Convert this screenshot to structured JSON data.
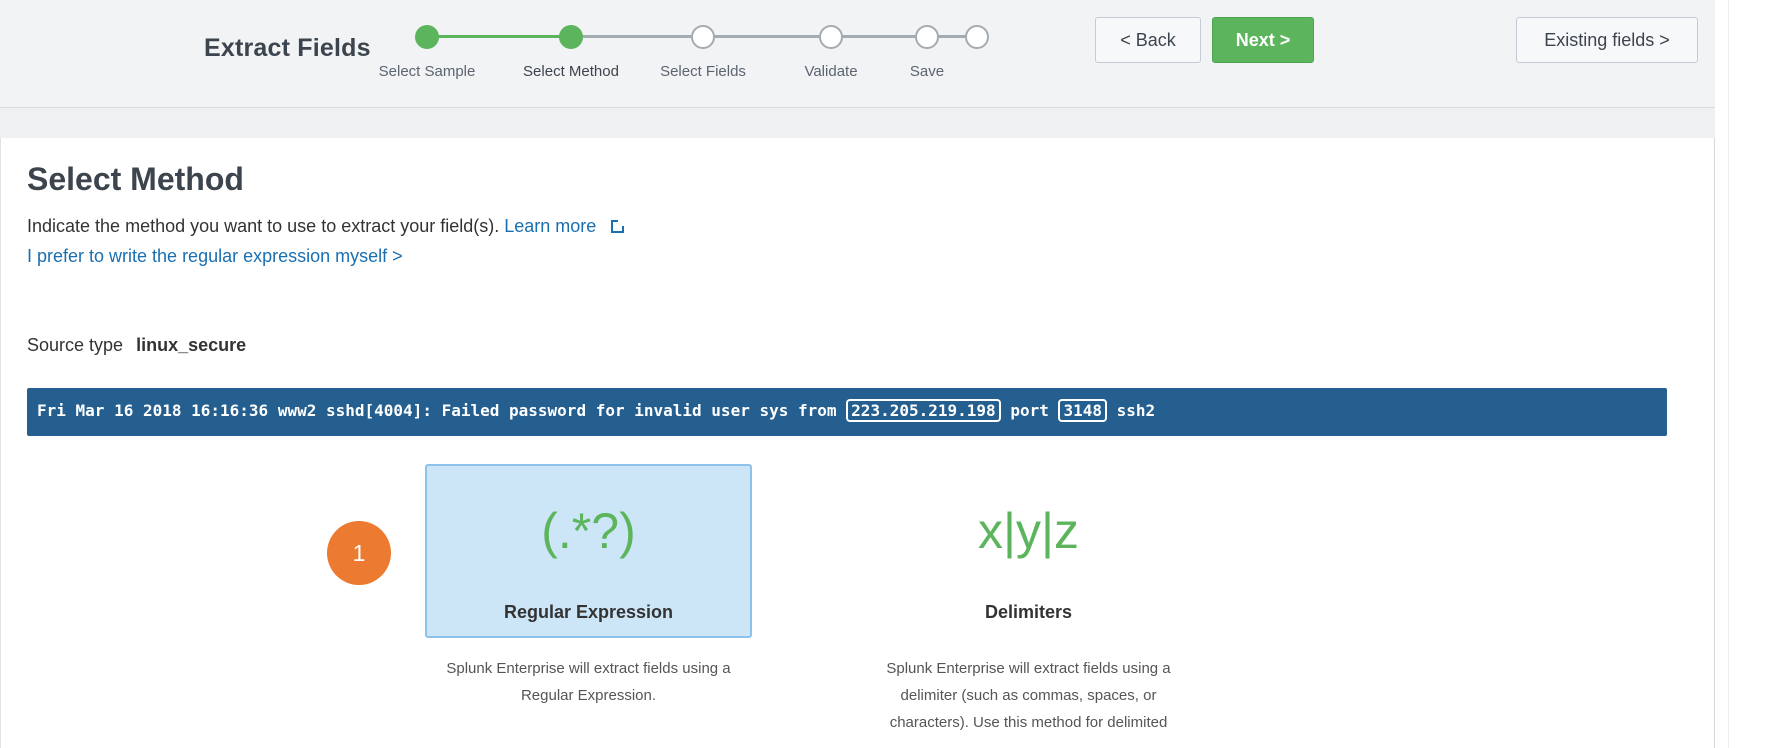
{
  "header": {
    "title": "Extract Fields",
    "steps": [
      {
        "label": "Select Sample",
        "state": "done"
      },
      {
        "label": "Select Method",
        "state": "current"
      },
      {
        "label": "Select Fields",
        "state": "todo"
      },
      {
        "label": "Validate",
        "state": "todo"
      },
      {
        "label": "Save",
        "state": "todo"
      }
    ],
    "back_label": "< Back",
    "next_label": "Next >",
    "existing_label": "Existing fields >"
  },
  "main": {
    "title": "Select Method",
    "intro_text": "Indicate the method you want to use to extract your field(s).",
    "learn_more": "Learn more",
    "regex_link": "I prefer to write the regular expression myself >",
    "source_type_label": "Source type",
    "source_type_value": "linux_secure",
    "event": {
      "prefix": "Fri Mar 16 2018 16:16:36 www2 sshd[4004]: Failed password for invalid user sys from",
      "ip": "223.205.219.198",
      "port_label": "port",
      "port": "3148",
      "suffix": "ssh2"
    },
    "methods": [
      {
        "symbol": "(.*?)",
        "name": "Regular Expression",
        "description": "Splunk Enterprise will extract fields using a Regular Expression.",
        "selected": true
      },
      {
        "symbol": "x|y|z",
        "name": "Delimiters",
        "description": "Splunk Enterprise will extract fields using a delimiter (such as commas, spaces, or characters). Use this method for delimited",
        "selected": false
      }
    ],
    "callout_number": "1"
  },
  "colors": {
    "accent_green": "#5cb55c",
    "event_bar": "#245f90",
    "link_blue": "#1a6fb0",
    "callout_orange": "#ec7a30",
    "selected_card": "#cce6f8"
  }
}
